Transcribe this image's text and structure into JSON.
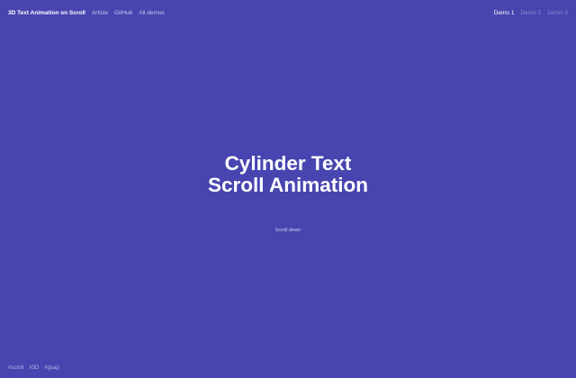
{
  "header": {
    "title": "3D Text Animation on Scroll",
    "links": [
      "Article",
      "GitHub",
      "All demos"
    ]
  },
  "demos": {
    "items": [
      "Demo 1",
      "Demo 2",
      "Demo 3"
    ],
    "active": "Demo 1"
  },
  "hero": {
    "line1": "Cylinder Text",
    "line2": "Scroll Animation"
  },
  "scroll_hint": "Scroll down",
  "tags": [
    "#scroll",
    "#3D",
    "#gsap"
  ],
  "colors": {
    "background": "#4845b0",
    "text": "#ffffff",
    "muted": "#8c89d4"
  }
}
